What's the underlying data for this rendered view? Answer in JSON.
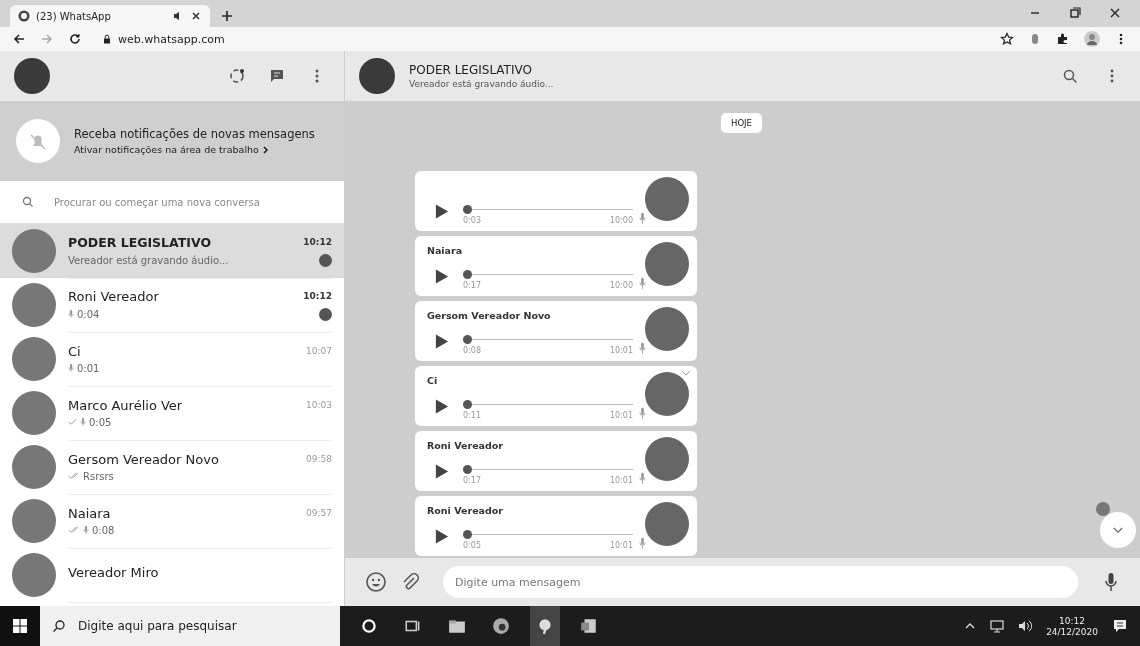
{
  "browser": {
    "tab_title": "(23) WhatsApp",
    "url": "web.whatsapp.com"
  },
  "notification": {
    "title": "Receba notificações de novas mensagens",
    "link": "Ativar notificações na área de trabalho"
  },
  "search": {
    "placeholder": "Procurar ou começar uma nova conversa"
  },
  "chats": [
    {
      "name": "PODER LEGISLATIVO",
      "preview": "Vereador está gravando áudio...",
      "time": "10:12",
      "selected": true,
      "unread": true,
      "sent": false,
      "delivered": false,
      "voice": false
    },
    {
      "name": "Roni Vereador",
      "preview": "0:04",
      "time": "10:12",
      "selected": false,
      "unread": true,
      "sent": false,
      "delivered": false,
      "voice": true
    },
    {
      "name": "Ci",
      "preview": "0:01",
      "time": "10:07",
      "selected": false,
      "unread": false,
      "sent": false,
      "delivered": false,
      "voice": true
    },
    {
      "name": "Marco Aurélio Ver",
      "preview": "0:05",
      "time": "10:03",
      "selected": false,
      "unread": false,
      "sent": true,
      "delivered": false,
      "voice": true
    },
    {
      "name": "Gersom Vereador Novo",
      "preview": "Rsrsrs",
      "time": "09:58",
      "selected": false,
      "unread": false,
      "sent": true,
      "delivered": true,
      "voice": false
    },
    {
      "name": "Naiara",
      "preview": "0:08",
      "time": "09:57",
      "selected": false,
      "unread": false,
      "sent": true,
      "delivered": true,
      "voice": true
    },
    {
      "name": "Vereador Miro",
      "selected": false,
      "unread": false,
      "sent": false,
      "delivered": false,
      "voice": false
    }
  ],
  "chat": {
    "title": "PODER LEGISLATIVO",
    "status": "Vereador está gravando áudio...",
    "date_chip": "HOJE",
    "messages": [
      {
        "duration": "0:03",
        "time": "10:00",
        "level": 0,
        "menu": false
      },
      {
        "sender": "Naiara",
        "duration": "0:17",
        "time": "10:00",
        "level": 0,
        "menu": false
      },
      {
        "sender": "Gersom Vereador Novo",
        "duration": "0:08",
        "time": "10:01",
        "level": 0,
        "menu": false
      },
      {
        "sender": "Ci",
        "duration": "0:11",
        "time": "10:01",
        "level": 0,
        "menu": true
      },
      {
        "sender": "Roni Vereador",
        "duration": "0:17",
        "time": "10:01",
        "level": 0,
        "menu": false
      },
      {
        "sender": "Roni Vereador",
        "duration": "0:05",
        "time": "10:01",
        "level": 0,
        "menu": false
      }
    ]
  },
  "composer": {
    "placeholder": "Digite uma mensagem"
  },
  "taskbar": {
    "search_placeholder": "Digite aqui para pesquisar",
    "time": "10:12",
    "date": "24/12/2020"
  }
}
